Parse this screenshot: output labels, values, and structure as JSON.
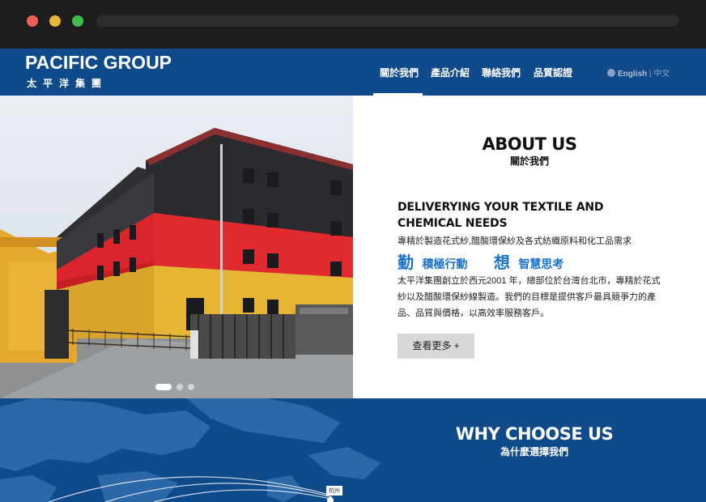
{
  "header": {
    "logo_en": "PACIFIC GROUP",
    "logo_zh": "太平洋集團",
    "nav": [
      "關於我們",
      "產品介紹",
      "聯絡我們",
      "品質認證"
    ],
    "lang_en": "English",
    "lang_sep": " | ",
    "lang_zh": "中文"
  },
  "hero": {
    "slides": 3,
    "active_slide": 1
  },
  "about": {
    "title": "ABOUT US",
    "subtitle": "關於我們",
    "heading": "DELIVERYING YOUR TEXTILE AND CHEMICAL NEEDS",
    "tagline": "專精於製造花式紗,醋酸環保紗及各式紡織原料和化工品需求",
    "motto_1_big": "勤",
    "motto_1_small": "積極行動",
    "motto_2_big": "想",
    "motto_2_small": "智慧思考",
    "description": "太平洋集團創立於西元2001 年，總部位於台灣台北市，專精於花式紗以及醋酸環保紗線製造。我們的目標是提供客戶最具競爭力的產品、品質與價格，以高效率服務客戶。",
    "more_button": "查看更多 +"
  },
  "why": {
    "title": "WHY CHOOSE US",
    "subtitle": "為什麼選擇我們",
    "city_label": "杭州"
  },
  "colors": {
    "brand_blue": "#0f4a8a",
    "motto_blue": "#1b73c9"
  }
}
